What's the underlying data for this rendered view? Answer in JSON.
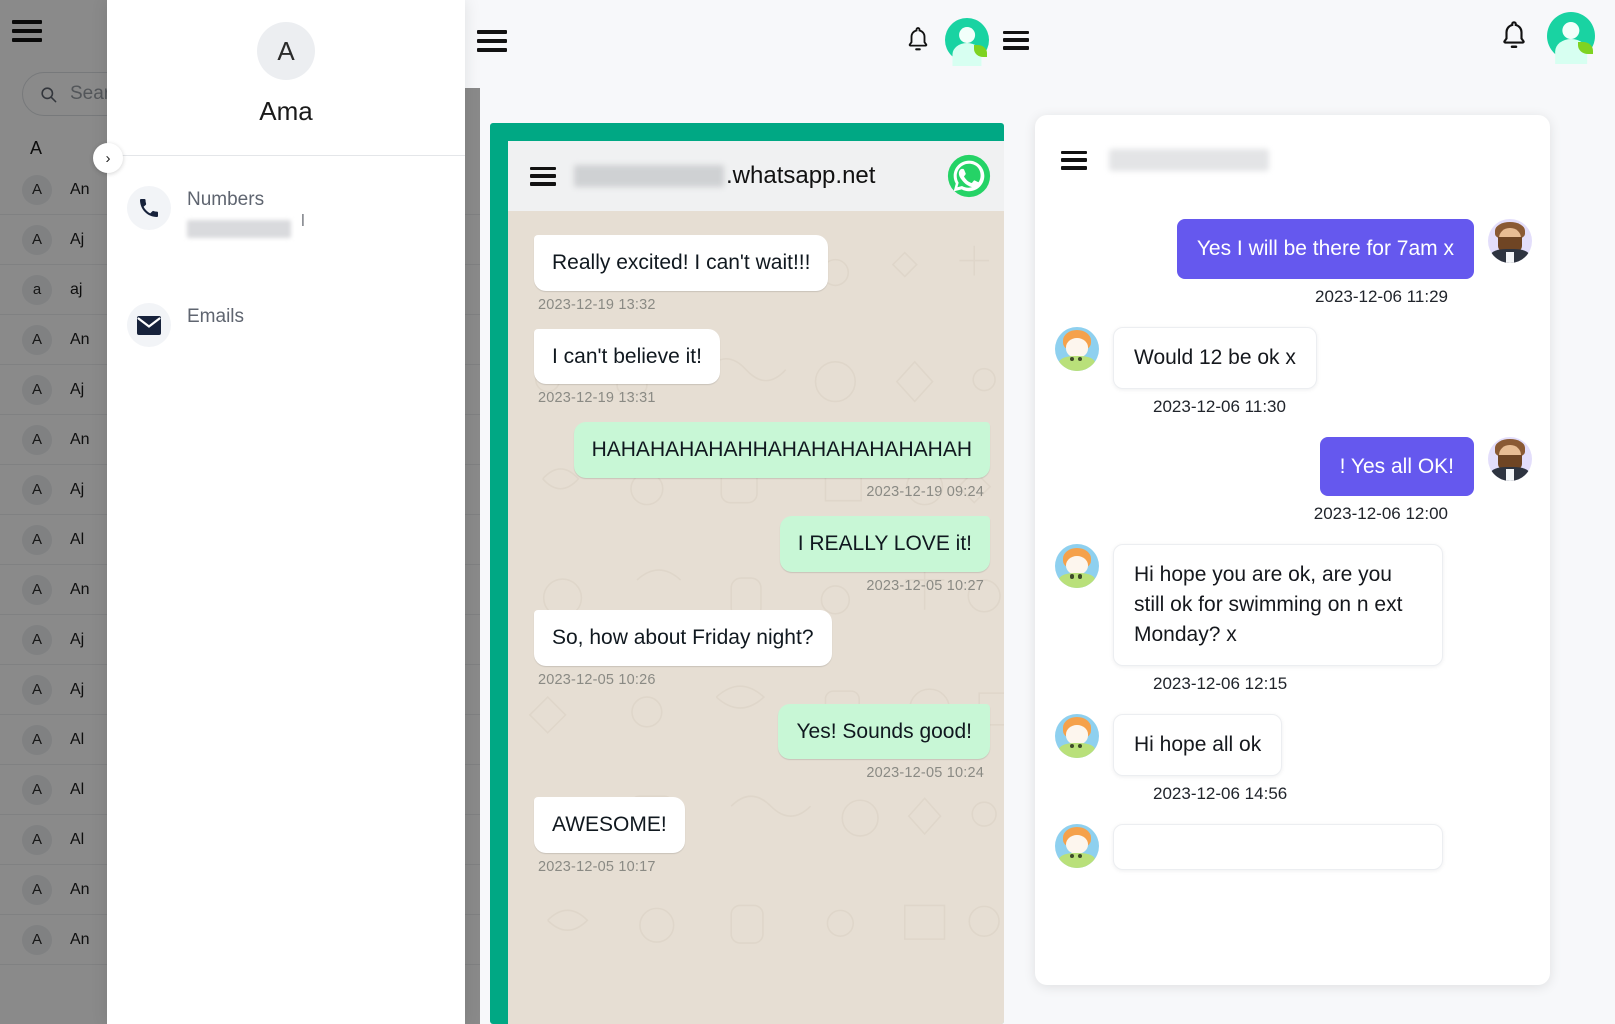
{
  "topbar": {
    "menu_icon": "hamburger-icon",
    "bell_icon": "notification-bell-icon",
    "avatar_icon": "user-avatar-icon"
  },
  "crm": {
    "search": {
      "placeholder": "Search",
      "icon": "search-icon"
    },
    "group_letter": "A",
    "contacts": [
      {
        "initial": "A",
        "name": "An"
      },
      {
        "initial": "A",
        "name": "Aj"
      },
      {
        "initial": "a",
        "name": "aj"
      },
      {
        "initial": "A",
        "name": "An"
      },
      {
        "initial": "A",
        "name": "Aj"
      },
      {
        "initial": "A",
        "name": "An"
      },
      {
        "initial": "A",
        "name": "Aj"
      },
      {
        "initial": "A",
        "name": "Al"
      },
      {
        "initial": "A",
        "name": "An"
      },
      {
        "initial": "A",
        "name": "Aj"
      },
      {
        "initial": "A",
        "name": "Aj"
      },
      {
        "initial": "A",
        "name": "Al"
      },
      {
        "initial": "A",
        "name": "Al"
      },
      {
        "initial": "A",
        "name": "Al"
      },
      {
        "initial": "A",
        "name": "An"
      },
      {
        "initial": "A",
        "name": "An"
      }
    ]
  },
  "contact_drawer": {
    "avatar_initial": "A",
    "name": "Ama",
    "expand_chevron": "›",
    "sections": [
      {
        "icon": "phone-icon",
        "label": "Numbers",
        "value": "",
        "value_redacted": true,
        "tail": "l"
      },
      {
        "icon": "envelope-icon",
        "label": "Emails",
        "value": "",
        "value_redacted": false
      }
    ]
  },
  "whatsapp": {
    "menu_icon": "hamburger-icon",
    "domain_prefix_redacted": true,
    "domain": ".whatsapp.net",
    "logo_icon": "whatsapp-icon",
    "messages": [
      {
        "dir": "in",
        "text": "Really excited! I can't wait!!!",
        "time": "2023-12-19 13:32"
      },
      {
        "dir": "in",
        "text": "I can't believe it!",
        "time": "2023-12-19 13:31"
      },
      {
        "dir": "out",
        "text": "HAHAHAHAHAHHAHAHAHAHAHAHAH",
        "time": "2023-12-19 09:24",
        "wide": true
      },
      {
        "dir": "out",
        "text": "I REALLY LOVE it!",
        "time": "2023-12-05 10:27"
      },
      {
        "dir": "in",
        "text": "So, how about Friday night?",
        "time": "2023-12-05 10:26"
      },
      {
        "dir": "out",
        "text": "Yes! Sounds good!",
        "time": "2023-12-05 10:24"
      },
      {
        "dir": "in",
        "text": "AWESOME!",
        "time": "2023-12-05 10:17"
      }
    ]
  },
  "right_chat": {
    "menu_icon": "hamburger-icon",
    "title_redacted": true,
    "messages": [
      {
        "dir": "out",
        "text": "Yes I will be there for 7am x",
        "time": "2023-12-06 11:29",
        "avatar": "man-avatar"
      },
      {
        "dir": "in",
        "text": "Would 12 be ok x",
        "time": "2023-12-06 11:30",
        "avatar": "woman-avatar"
      },
      {
        "dir": "out",
        "text": "! Yes all OK!",
        "time": "2023-12-06 12:00",
        "avatar": "man-avatar"
      },
      {
        "dir": "in",
        "text": "Hi hope you are ok, are you still ok for swimming on n ext Monday? x",
        "time": "2023-12-06 12:15",
        "avatar": "woman-avatar"
      },
      {
        "dir": "in",
        "text": "Hi hope all ok",
        "time": "2023-12-06 14:56",
        "avatar": "woman-avatar"
      },
      {
        "dir": "in",
        "text": "",
        "time": "",
        "avatar": "woman-avatar",
        "empty": true
      }
    ]
  },
  "colors": {
    "whatsapp_frame": "#00a884",
    "whatsapp_out_bubble": "#c8f7d6",
    "chat_out_bubble": "#6558ee",
    "brand_avatar": "#19d3a2",
    "page_background": "#f7f8fa"
  }
}
